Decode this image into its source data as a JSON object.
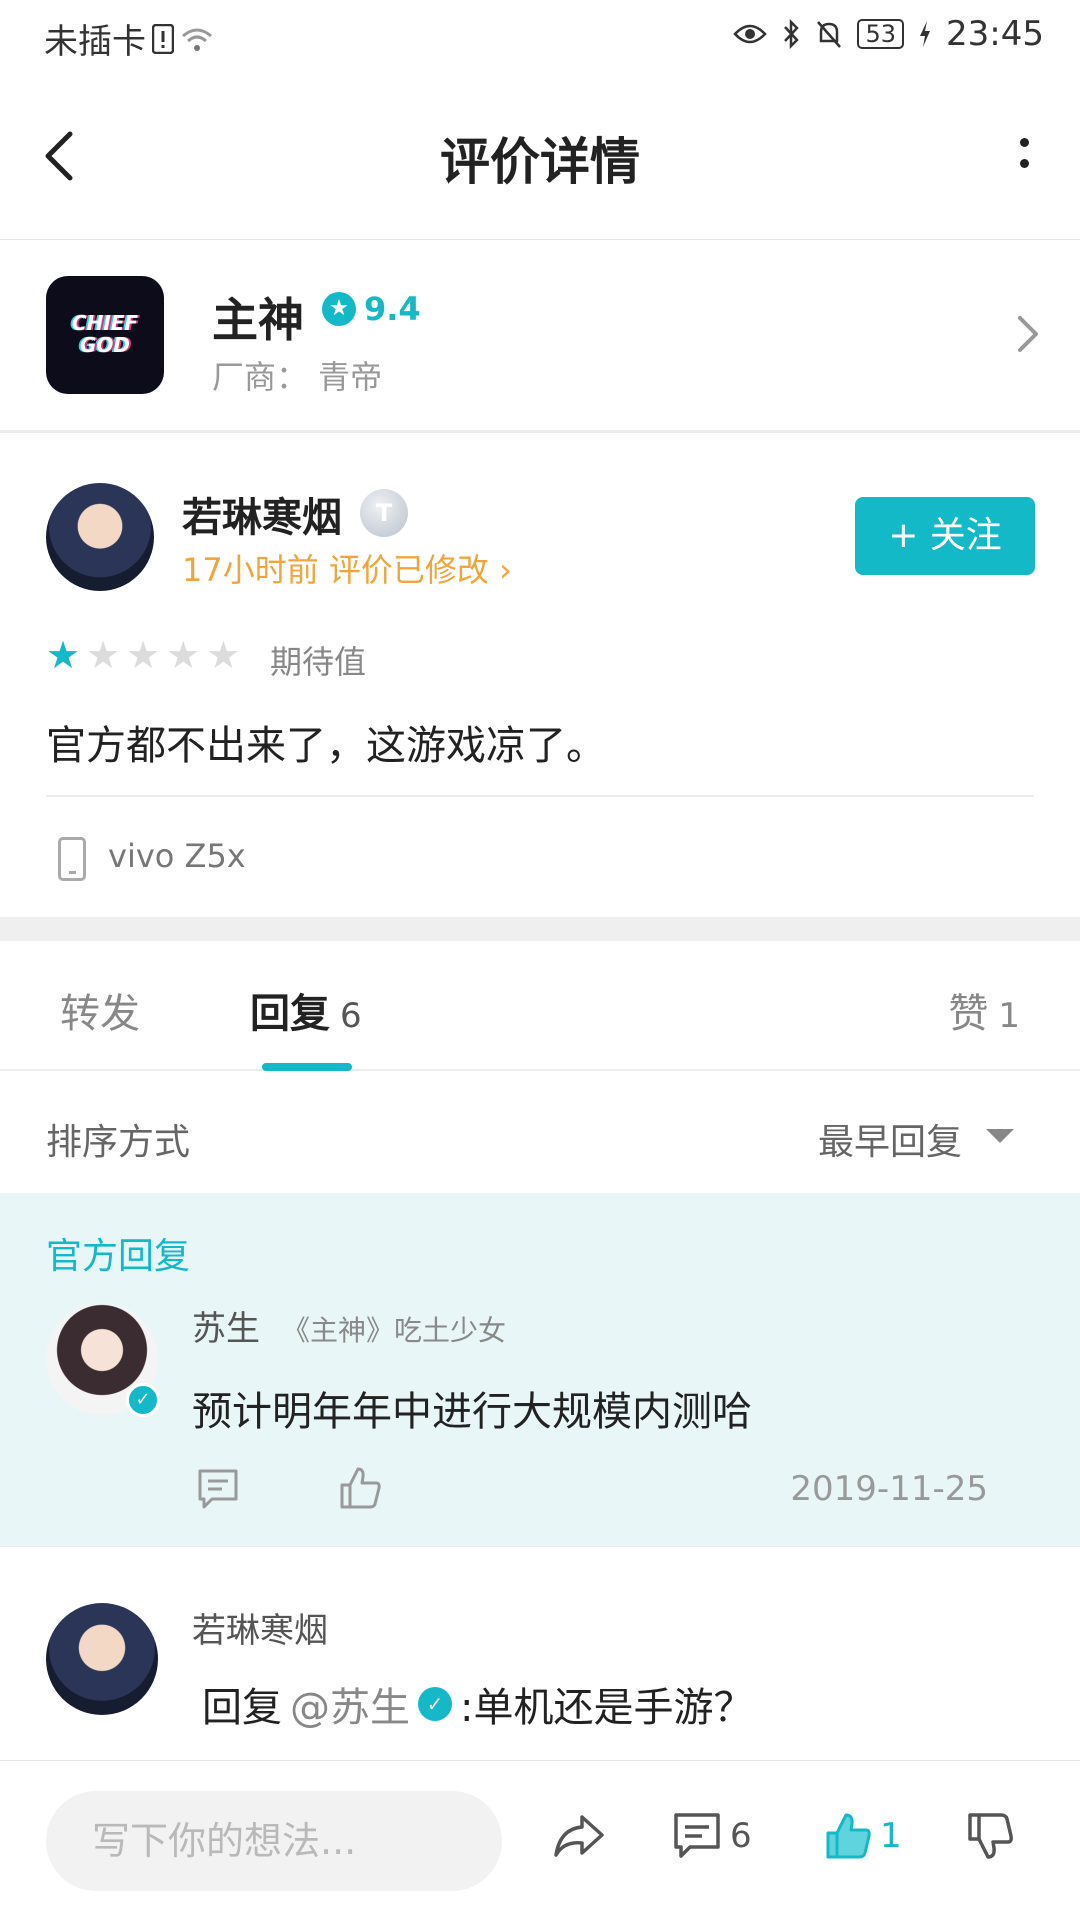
{
  "status_bar": {
    "carrier": "未插卡",
    "battery": "53",
    "time": "23:45"
  },
  "header": {
    "title": "评价详情"
  },
  "app": {
    "icon_text": "CHIEF GOD",
    "name": "主神",
    "score": "9.4",
    "vendor": "厂商：  青帝"
  },
  "review": {
    "author": "若琳寒烟",
    "level_badge": "T",
    "meta": "17小时前 评价已修改 ›",
    "follow_label": "+ 关注",
    "rating": 1,
    "rating_max": 5,
    "expect_label": "期待值",
    "text": "官方都不出来了，这游戏凉了。",
    "device": "vivo Z5x"
  },
  "tabs": {
    "forward": "转发",
    "reply": "回复",
    "reply_count": "6",
    "like": "赞",
    "like_count": "1"
  },
  "sort": {
    "label": "排序方式",
    "value": "最早回复"
  },
  "official_reply": {
    "tag": "官方回复",
    "author": "苏生",
    "title": "《主神》吃土少女",
    "text": "预计明年年中进行大规模内测哈",
    "date": "2019-11-25"
  },
  "reply": {
    "author": "若琳寒烟",
    "prefix": "回复",
    "mention": "@苏生",
    "text": ":单机还是手游？"
  },
  "bottom_bar": {
    "placeholder": "写下你的想法...",
    "comment_count": "6",
    "like_count": "1"
  },
  "colors": {
    "accent": "#14b9c8",
    "orange": "#f0a63a",
    "official_bg": "#e9f6f8"
  }
}
